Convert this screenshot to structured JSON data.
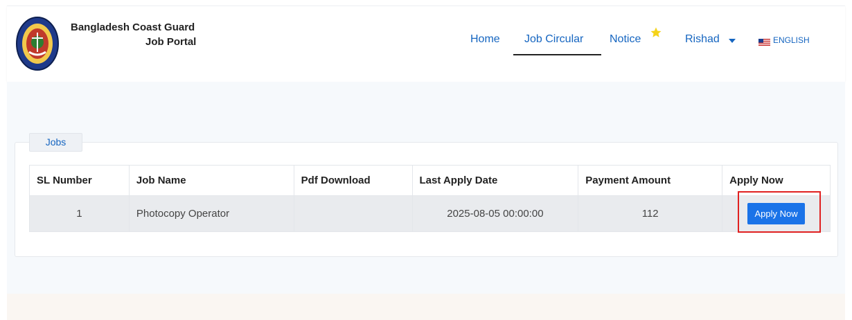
{
  "header": {
    "brand_line1": "Bangladesh Coast Guard",
    "brand_line2": "Job Portal",
    "nav": {
      "home": "Home",
      "job_circular": "Job Circular",
      "notice": "Notice",
      "user": "Rishad",
      "language": "ENGLISH"
    },
    "icons": [
      "logo-emblem",
      "star-icon",
      "chevron-down-icon",
      "us-flag-icon"
    ]
  },
  "jobs": {
    "tab_label": "Jobs",
    "columns": [
      "SL Number",
      "Job Name",
      "Pdf Download",
      "Last Apply Date",
      "Payment Amount",
      "Apply Now"
    ],
    "rows": [
      {
        "sl": "1",
        "job_name": "Photocopy Operator",
        "pdf": "",
        "last_apply_date": "2025-08-05 00:00:00",
        "payment_amount": "112",
        "apply_label": "Apply Now"
      }
    ]
  },
  "colors": {
    "accent": "#1a73e8",
    "nav_text": "#1565c0",
    "highlight": "#e02020",
    "star": "#f5d31a"
  }
}
